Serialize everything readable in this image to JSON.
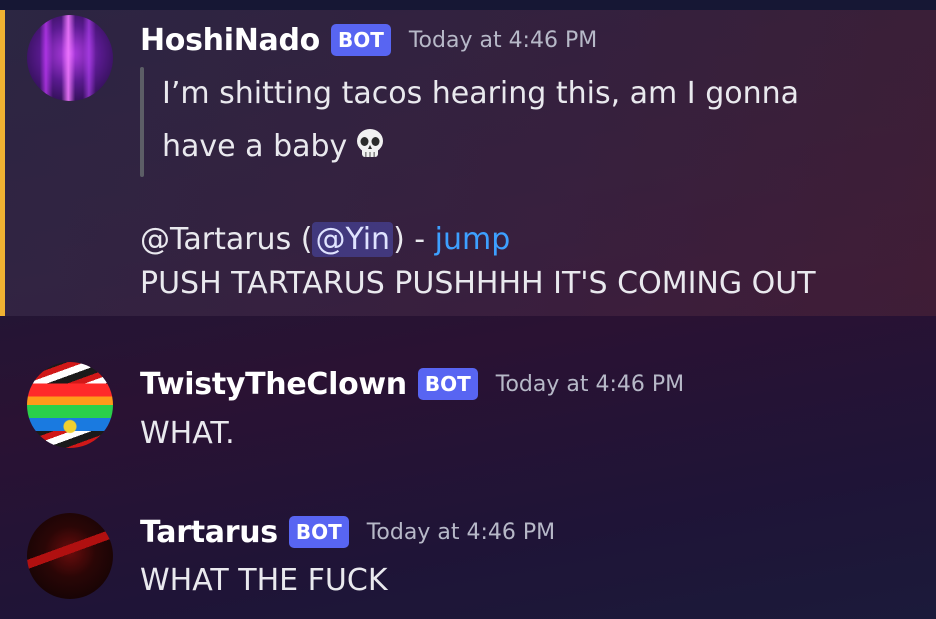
{
  "messages": [
    {
      "username": "HoshiNado",
      "badge": "BOT",
      "timestamp": "Today at 4:46 PM",
      "quote_text": "I’m shitting tacos hearing this, am I gonna have a baby",
      "reply_prefix": "@Tartarus (",
      "reply_mention": "@Yin",
      "reply_separator": ") - ",
      "reply_jump": "jump",
      "content": " PUSH TARTARUS PUSHHHH IT'S COMING OUT"
    },
    {
      "username": "TwistyTheClown",
      "badge": "BOT",
      "timestamp": "Today at 4:46 PM",
      "content": "WHAT."
    },
    {
      "username": "Tartarus",
      "badge": "BOT",
      "timestamp": "Today at 4:46 PM",
      "content": "WHAT THE FUCK"
    }
  ],
  "icons": {
    "emoji": "skull-emoji"
  },
  "colors": {
    "bot_badge": "#5865f2",
    "highlight_bar": "#f0b132",
    "link": "#3da0ff"
  }
}
